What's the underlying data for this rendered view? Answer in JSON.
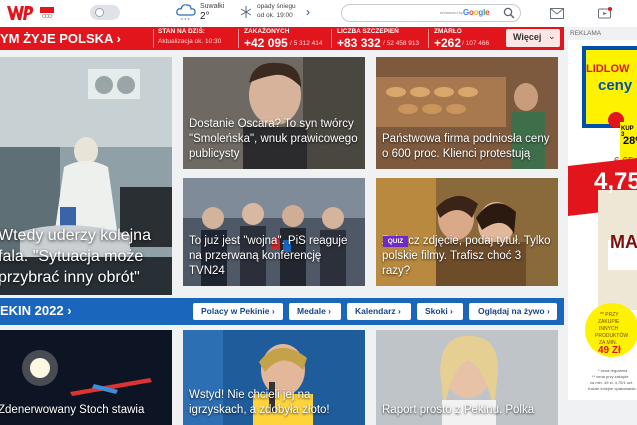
{
  "colors": {
    "brand_red": "#e2151c",
    "olympic_blue": "#1a66bd",
    "quiz_purple": "#6d2bc4"
  },
  "header": {
    "weather": {
      "city": "Suwałki",
      "temp": "2°",
      "forecast_line1": "opady śniegu",
      "forecast_line2": "od ok. 19:00",
      "icon": "snow-cloud-icon"
    },
    "search": {
      "prefix": "enhanced by",
      "brand": "Google",
      "placeholder": ""
    },
    "icons": [
      "mail-icon",
      "tv-icon"
    ]
  },
  "section": {
    "title": "YM ŻYJE POLSKA ›",
    "stats_title": "STAN NA DZIŚ:",
    "updated": "Aktualizacja ok. 10:30",
    "stats": [
      {
        "label": "ZAKAŻONYCH",
        "big": "+42 095",
        "small": "/ 5 312 414"
      },
      {
        "label": "LICZBA SZCZEPIEŃ",
        "big": "+83 332",
        "small": "/ 52 458 913"
      },
      {
        "label": "ZMARŁO",
        "big": "+262",
        "small": "/ 107 466"
      }
    ],
    "more_label": "Więcej"
  },
  "tiles": [
    {
      "caption": "Wtedy uderzy kolejna fala. \"Sytuacja może przybrać inny obrót\""
    },
    {
      "caption": "Dostanie Oscara? To syn twórcy \"Smoleńska\", wnuk prawicowego publicysty"
    },
    {
      "caption": "Państwowa firma podniosła ceny o 600 proc. Klienci protestują"
    },
    {
      "caption": "To już jest \"wojna\". PiS reaguje na przerwaną konferencję TVN24"
    },
    {
      "caption": "Zobacz zdjęcie, podaj tytuł. Tylko polskie filmy. Trafisz choć 3 razy?",
      "badge": "QUIZ"
    }
  ],
  "olympics": {
    "title": "EKIN 2022 ›",
    "links": [
      "Polacy w Pekinie ›",
      "Medale ›",
      "Kalendarz ›",
      "Skoki ›",
      "Oglądaj na żywo ›"
    ],
    "tiles": [
      {
        "caption": "Zdenerwowany Stoch stawia"
      },
      {
        "caption": "Wstyd! Nie chcieli jej na igrzyskach, a zdobyła złoto!"
      },
      {
        "caption": "Raport prosto z Pekinu. Polka"
      }
    ]
  },
  "ad": {
    "label": "REKLAMA",
    "brand_line1": "LIDLOW",
    "brand_line2": "ceny",
    "promo1": "KUP 3",
    "promo2": "28%",
    "old_price": "6,65",
    "new_price": "4,75",
    "product": "MA",
    "promo_circle": [
      "** PRZY",
      "ZAKUPIE",
      "INNYCH",
      "PRODUKTÓW",
      "ZA MIN.",
      "49 Zł"
    ],
    "fine1": "* cena regularna",
    "fine2": "** cena przy zakupie",
    "fine3": "za min. 49 zł. 4,75/1 szt.",
    "fine4": "Każde kolejne opakowanie"
  }
}
